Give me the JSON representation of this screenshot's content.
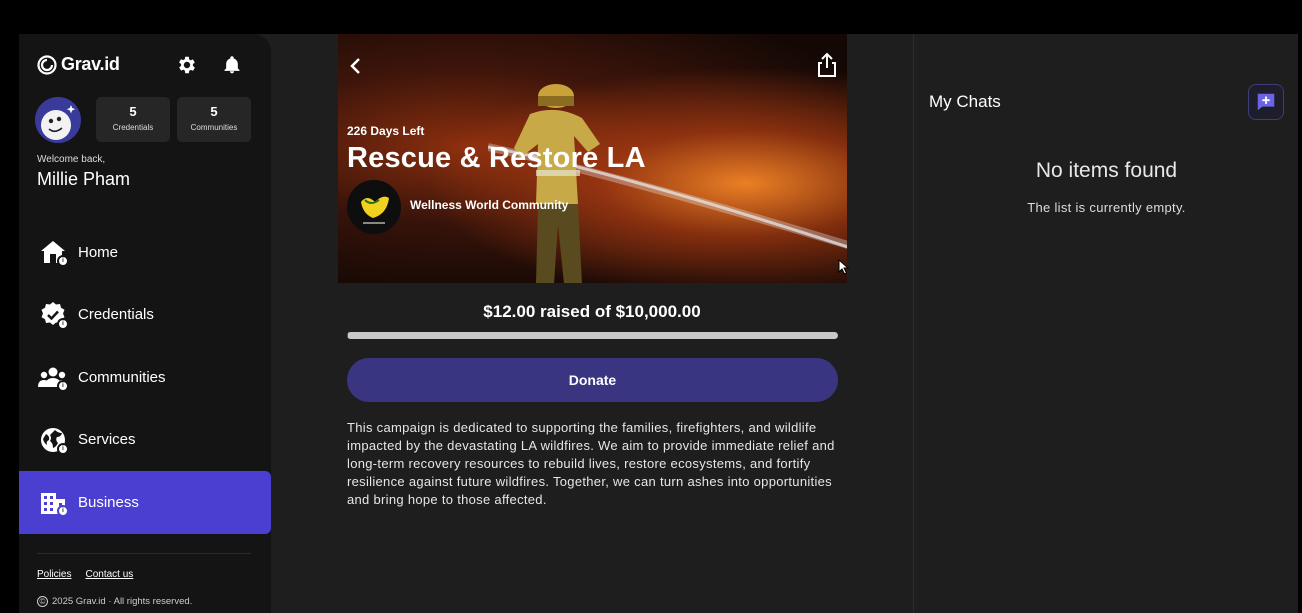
{
  "sidebar": {
    "logo_text": "Grav.id",
    "stats": [
      {
        "value": "5",
        "label": "Credentials"
      },
      {
        "value": "5",
        "label": "Communities"
      }
    ],
    "welcome": "Welcome back,",
    "user_name": "Millie Pham",
    "nav": [
      {
        "label": "Home",
        "icon": "home-icon"
      },
      {
        "label": "Credentials",
        "icon": "credentials-icon"
      },
      {
        "label": "Communities",
        "icon": "communities-icon"
      },
      {
        "label": "Services",
        "icon": "services-icon"
      },
      {
        "label": "Business",
        "icon": "business-icon",
        "active": true
      }
    ],
    "footer": {
      "policies": "Policies",
      "contact": "Contact us",
      "copyright": "2025 Grav.id · All rights reserved."
    }
  },
  "campaign": {
    "days_left": "226 Days Left",
    "title": "Rescue & Restore LA",
    "org_name": "Wellness World Community",
    "raised_text": "$12.00 raised of $10,000.00",
    "progress_fraction": 0.0012,
    "donate_label": "Donate",
    "description": "This campaign is dedicated to supporting the families, firefighters, and wildlife impacted by the devastating LA wildfires. We aim to provide immediate relief and long-term recovery resources to rebuild lives, restore ecosystems, and fortify resilience against future wildfires. Together, we can turn ashes into opportunities and bring hope to those affected."
  },
  "chats": {
    "title": "My Chats",
    "empty_title": "No items found",
    "empty_subtitle": "The list is currently empty."
  },
  "colors": {
    "accent": "#4a3fd0",
    "donate_button": "#3a3580",
    "sidebar_bg": "#141414",
    "panel_bg": "#1e1e1e"
  }
}
